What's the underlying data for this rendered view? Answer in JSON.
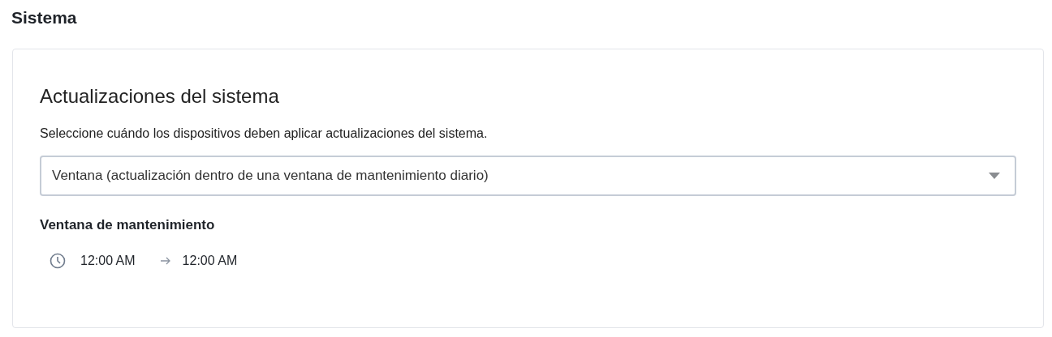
{
  "page_title": "Sistema",
  "card": {
    "title": "Actualizaciones del sistema",
    "description": "Seleccione cuándo los dispositivos deben aplicar actualizaciones del sistema.",
    "select": {
      "value": "Ventana (actualización dentro de una ventana de mantenimiento diario)"
    },
    "window_label": "Ventana de mantenimiento",
    "time_range": {
      "start": "12:00 AM",
      "end": "12:00 AM"
    }
  }
}
